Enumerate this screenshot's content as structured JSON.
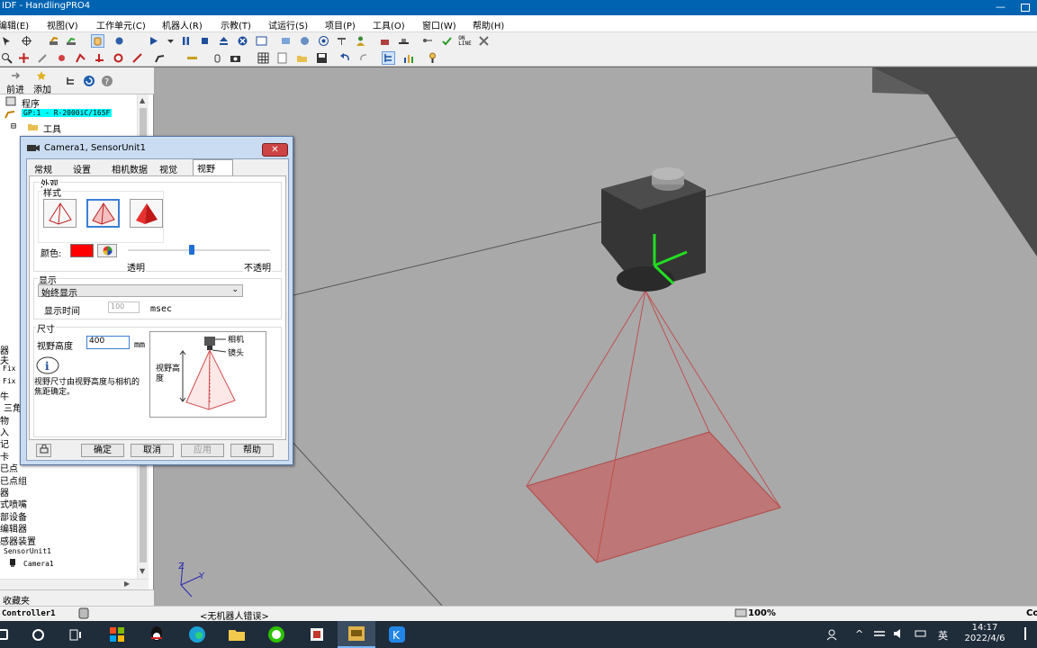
{
  "app": {
    "title": "IDF - HandlingPRO4"
  },
  "menu": [
    "编辑(E)",
    "视图(V)",
    "工作单元(C)",
    "机器人(R)",
    "示教(T)",
    "试运行(S)",
    "项目(P)",
    "工具(O)",
    "窗口(W)",
    "帮助(H)"
  ],
  "nav": {
    "back": "前进",
    "add": "添加"
  },
  "tree": {
    "program": "程序",
    "robot": "GP:1 - R-2000iC/165F",
    "tool": "工具",
    "items": [
      "器",
      "夫",
      "Fix",
      "Fix",
      "牛",
      "三角",
      "物",
      "入",
      "记",
      "卡",
      "已点",
      "已点组",
      "器",
      "式喷嘴",
      "部设备",
      "编辑器",
      "感器装置"
    ],
    "sensor": "SensorUnit1",
    "camera": "Camera1"
  },
  "favorites": "收藏夹",
  "status": {
    "left": "Controller1",
    "msg": "<无机器人错误>",
    "zoom": "100%",
    "right": "Co"
  },
  "clock": {
    "time": "14:17",
    "date": "2022/4/6"
  },
  "tray": {
    "ime": "英"
  },
  "dialog": {
    "title": "Camera1, SensorUnit1",
    "tabs": [
      "常规",
      "设置",
      "相机数据",
      "视觉",
      "视野"
    ],
    "appearance": "外观",
    "style": "样式",
    "color_label": "颜色:",
    "color_value": "#ff0000",
    "transparent": "透明",
    "opaque": "不透明",
    "opacity_level": 0.45,
    "display": "显示",
    "display_mode": "始终显示",
    "display_time_label": "显示时间",
    "display_time": "100",
    "msec": "msec",
    "size": "尺寸",
    "fov_height_label": "视野高度",
    "fov_height": "400",
    "mm": "mm",
    "info": "视野尺寸由视野高度与相机的焦距确定。",
    "diag_camera": "相机",
    "diag_lens": "镜头",
    "diag_fov_height": "视野高度",
    "ok": "确定",
    "cancel": "取消",
    "apply": "应用",
    "help": "帮助"
  },
  "axes": {
    "y": "Y",
    "z": "Z"
  }
}
